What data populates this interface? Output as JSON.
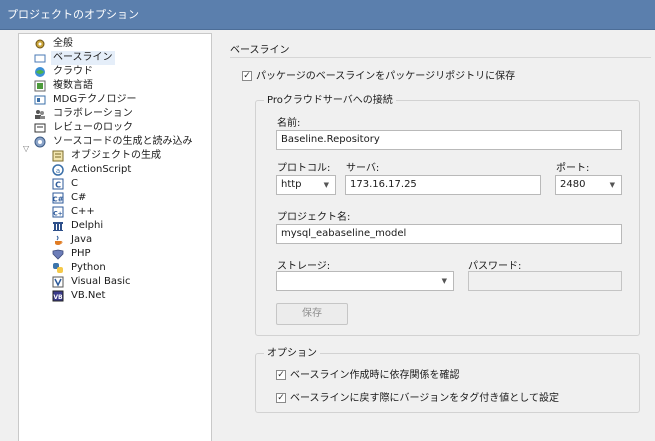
{
  "window": {
    "title": "プロジェクトのオプション"
  },
  "tree": {
    "items": [
      {
        "label": "全般",
        "icon": "gear-icon"
      },
      {
        "label": "ベースライン",
        "icon": "folder-icon",
        "selected": true
      },
      {
        "label": "クラウド",
        "icon": "globe-icon"
      },
      {
        "label": "複数言語",
        "icon": "languages-icon"
      },
      {
        "label": "MDGテクノロジー",
        "icon": "mdg-icon"
      },
      {
        "label": "コラボレーション",
        "icon": "users-icon"
      },
      {
        "label": "レビューのロック",
        "icon": "lock-icon"
      },
      {
        "label": "ソースコードの生成と読み込み",
        "icon": "gears-icon",
        "expanded": true
      },
      {
        "label": "オブジェクトの生成",
        "icon": "object-icon"
      },
      {
        "label": "ActionScript",
        "icon": "actionscript-icon"
      },
      {
        "label": "C",
        "icon": "c-icon"
      },
      {
        "label": "C#",
        "icon": "csharp-icon"
      },
      {
        "label": "C++",
        "icon": "cpp-icon"
      },
      {
        "label": "Delphi",
        "icon": "delphi-icon"
      },
      {
        "label": "Java",
        "icon": "java-icon"
      },
      {
        "label": "PHP",
        "icon": "php-icon"
      },
      {
        "label": "Python",
        "icon": "python-icon"
      },
      {
        "label": "Visual Basic",
        "icon": "vb-icon"
      },
      {
        "label": "VB.Net",
        "icon": "vbnet-icon"
      }
    ]
  },
  "baseline": {
    "title": "ベースライン",
    "save_to_repo_label": "パッケージのベースラインをパッケージリポジトリに保存",
    "save_to_repo_checked": true,
    "server_group": {
      "title": "Proクラウドサーバへの接続",
      "name_label": "名前:",
      "name_value": "Baseline.Repository",
      "protocol_label": "プロトコル:",
      "protocol_value": "http",
      "server_label": "サーバ:",
      "server_value": "173.16.17.25",
      "port_label": "ポート:",
      "port_value": "2480",
      "project_label": "プロジェクト名:",
      "project_value": "mysql_eabaseline_model",
      "storage_label": "ストレージ:",
      "storage_value": "",
      "password_label": "パスワード:",
      "password_value": "",
      "save_button": "保存"
    },
    "options_group": {
      "title": "オプション",
      "check_dependencies_label": "ベースライン作成時に依存関係を確認",
      "check_dependencies_checked": true,
      "tag_version_label": "ベースラインに戻す際にバージョンをタグ付き値として設定",
      "tag_version_checked": true
    }
  },
  "colors": {
    "titlebar": "#5b7fad",
    "selection": "#e5eef9",
    "background": "#f0f0f0"
  }
}
